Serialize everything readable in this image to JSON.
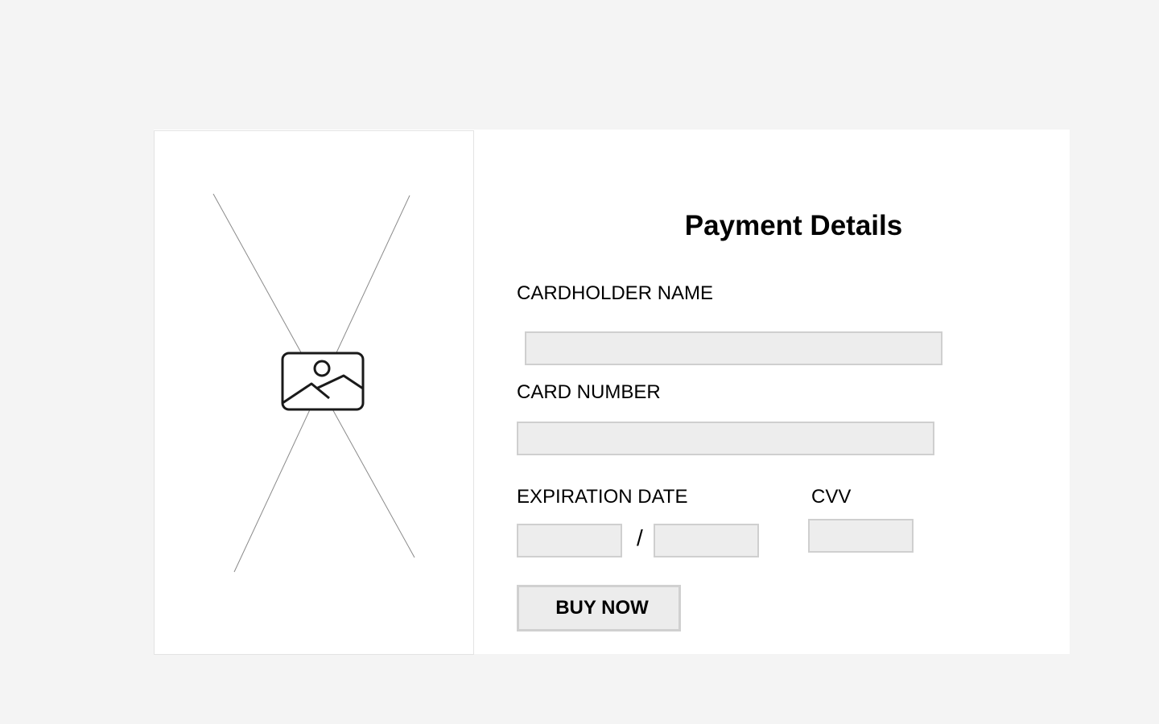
{
  "product_image": {
    "icon": "image-placeholder-icon"
  },
  "form": {
    "title": "Payment Details",
    "cardholder_name": {
      "label": "CARDHOLDER NAME",
      "value": "",
      "placeholder": ""
    },
    "card_number": {
      "label": "CARD NUMBER",
      "value": "",
      "placeholder": ""
    },
    "expiration": {
      "label": "EXPIRATION DATE",
      "separator": "/",
      "month_value": "",
      "year_value": ""
    },
    "cvv": {
      "label": "CVV",
      "value": ""
    },
    "buy_button": {
      "label": "BUY NOW"
    }
  },
  "colors": {
    "page_background": "#f4f4f4",
    "card_background": "#ffffff",
    "input_background": "#ededed",
    "input_border": "#cfcfcf"
  }
}
